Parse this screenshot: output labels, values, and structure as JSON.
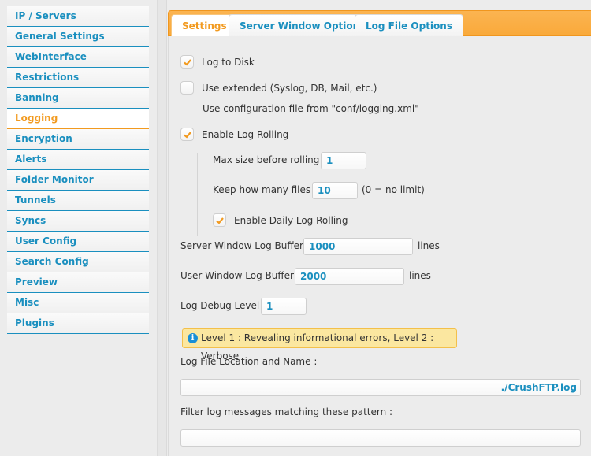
{
  "sidebar": {
    "items": [
      {
        "label": "IP / Servers"
      },
      {
        "label": "General Settings"
      },
      {
        "label": "WebInterface"
      },
      {
        "label": "Restrictions"
      },
      {
        "label": "Banning"
      },
      {
        "label": "Logging",
        "active": true
      },
      {
        "label": "Encryption"
      },
      {
        "label": "Alerts"
      },
      {
        "label": "Folder Monitor"
      },
      {
        "label": "Tunnels"
      },
      {
        "label": "Syncs"
      },
      {
        "label": "User Config"
      },
      {
        "label": "Search Config"
      },
      {
        "label": "Preview"
      },
      {
        "label": "Misc"
      },
      {
        "label": "Plugins"
      }
    ]
  },
  "tabs": [
    {
      "label": "Settings",
      "active": true
    },
    {
      "label": "Server Window Options"
    },
    {
      "label": "Log File Options"
    }
  ],
  "settings": {
    "log_to_disk": {
      "label": "Log to Disk",
      "checked": true
    },
    "use_extended": {
      "label": "Use extended (Syslog, DB, Mail, etc.)",
      "checked": false
    },
    "use_config_note": "Use configuration file from \"conf/logging.xml\"",
    "enable_log_rolling": {
      "label": "Enable Log Rolling",
      "checked": true
    },
    "max_size": {
      "label": "Max size before rolling :",
      "value": "1"
    },
    "keep_files": {
      "label": "Keep how many files :",
      "value": "10",
      "suffix": "(0 = no limit)"
    },
    "daily_rolling": {
      "label": "Enable Daily Log Rolling",
      "checked": true
    },
    "server_buffer": {
      "label": "Server Window Log Buffer :",
      "value": "1000",
      "suffix": "lines"
    },
    "user_buffer": {
      "label": "User Window Log Buffer :",
      "value": "2000",
      "suffix": "lines"
    },
    "debug_level": {
      "label": "Log Debug Level :",
      "value": "1"
    },
    "info_note": "Level 1 : Revealing informational errors, Level 2 : Verbose",
    "info_icon": "i",
    "log_location": {
      "label": "Log File Location and Name :",
      "value": "./CrushFTP.log"
    },
    "filter": {
      "label": "Filter log messages matching these pattern :",
      "value": ""
    }
  },
  "colors": {
    "accent": "#f29a1f",
    "link": "#1a8fbf",
    "tabbar": "#f9a93a",
    "info_bg": "#fbe7a0"
  }
}
